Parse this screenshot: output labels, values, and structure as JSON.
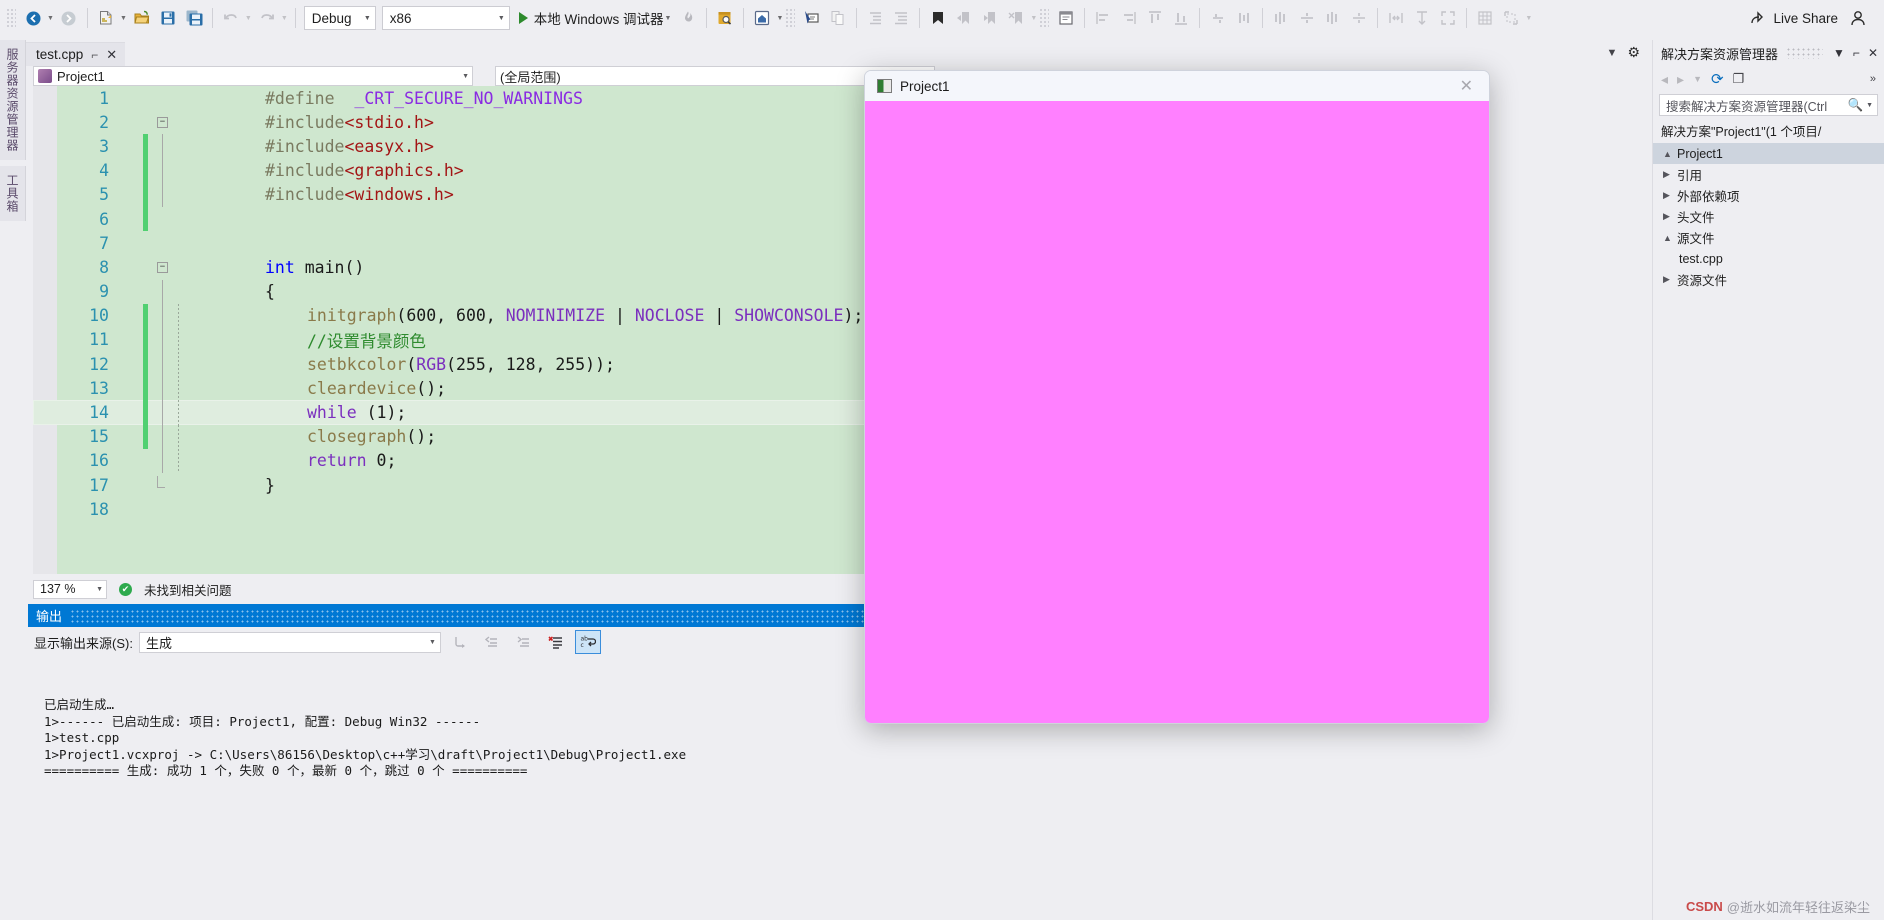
{
  "toolbar": {
    "nav_back_icon": "back-arrow-icon",
    "nav_forward_icon": "forward-arrow-icon",
    "new_item_icon": "new-file-icon",
    "open_icon": "open-folder-icon",
    "save_icon": "save-icon",
    "save_all_icon": "save-all-icon",
    "undo_icon": "undo-icon",
    "redo_icon": "redo-icon",
    "config_value": "Debug",
    "platform_value": "x86",
    "run_label": "本地 Windows 调试器",
    "hot_reload_icon": "hot-reload-icon",
    "find_icon": "find-in-files-icon",
    "home_icon": "home-icon",
    "pointer_icon": "select-element-icon",
    "copy_icon": "copy-icon",
    "indent_icon": "decrease-indent-icon",
    "outdent_icon": "increase-indent-icon",
    "bookmark_icon": "bookmark-icon",
    "prev_bookmark_icon": "previous-bookmark-icon",
    "next_bookmark_icon": "next-bookmark-icon",
    "clear_bookmark_icon": "clear-bookmarks-icon",
    "window_icon": "window-icon",
    "align_left_icon": "align-left-icon",
    "align_right_icon": "align-right-icon",
    "align_top_icon": "align-top-icon",
    "align_bottom_icon": "align-bottom-icon",
    "center_h_icon": "center-horizontally-icon",
    "center_v_icon": "center-vertically-icon",
    "space_h_icon": "space-horizontally-icon",
    "space_v_icon": "space-vertically-icon",
    "size_icon": "make-same-size-icon",
    "height_icon": "size-height-icon",
    "expand_icon": "size-to-fit-icon",
    "grid_icon": "show-grid-icon",
    "tab_order_icon": "tab-order-icon",
    "live_share_label": "Live Share",
    "account_icon": "user-account-icon"
  },
  "left_tabs": [
    {
      "label": "服务器资源管理器"
    },
    {
      "label": "工具箱"
    }
  ],
  "document_tab": {
    "title": "test.cpp",
    "pin_icon": "pin-icon",
    "close_icon": "close-icon"
  },
  "tabstrip_right": {
    "dropdown_icon": "chevron-down-icon",
    "settings_icon": "gear-icon"
  },
  "navbar": {
    "project_scope": "Project1",
    "member_scope": "(全局范围)"
  },
  "editor": {
    "lines": [
      {
        "num": "1",
        "change": false,
        "fold": "",
        "vline": "none",
        "indent": 0,
        "segments": [
          {
            "t": "#define  ",
            "c": "t-pp"
          },
          {
            "t": "_CRT_SECURE_NO_WARNINGS",
            "c": "t-mac"
          }
        ]
      },
      {
        "num": "2",
        "change": false,
        "fold": "-",
        "vline": "none",
        "indent": 0,
        "segments": [
          {
            "t": "#include",
            "c": "t-pp"
          },
          {
            "t": "<stdio.h>",
            "c": "t-str"
          }
        ]
      },
      {
        "num": "3",
        "change": true,
        "fold": "",
        "vline": "solid",
        "indent": 0,
        "segments": [
          {
            "t": "#include",
            "c": "t-pp"
          },
          {
            "t": "<easyx.h>",
            "c": "t-str"
          }
        ]
      },
      {
        "num": "4",
        "change": true,
        "fold": "",
        "vline": "solid",
        "indent": 0,
        "segments": [
          {
            "t": "#include",
            "c": "t-pp"
          },
          {
            "t": "<graphics.h>",
            "c": "t-str"
          }
        ]
      },
      {
        "num": "5",
        "change": true,
        "fold": "",
        "vline": "solid",
        "indent": 0,
        "segments": [
          {
            "t": "#include",
            "c": "t-pp"
          },
          {
            "t": "<windows.h>",
            "c": "t-str"
          }
        ]
      },
      {
        "num": "6",
        "change": true,
        "fold": "",
        "vline": "none",
        "indent": 0,
        "segments": []
      },
      {
        "num": "7",
        "change": false,
        "fold": "",
        "vline": "none",
        "indent": 0,
        "segments": []
      },
      {
        "num": "8",
        "change": false,
        "fold": "-",
        "vline": "none",
        "indent": 0,
        "segments": [
          {
            "t": "int",
            "c": "t-kw"
          },
          {
            "t": " main()",
            "c": "t-plain"
          }
        ]
      },
      {
        "num": "9",
        "change": false,
        "fold": "",
        "vline": "solid",
        "indent": 0,
        "segments": [
          {
            "t": "{",
            "c": "t-plain"
          }
        ]
      },
      {
        "num": "10",
        "change": true,
        "fold": "",
        "vline": "both",
        "indent": 1,
        "segments": [
          {
            "t": "initgraph",
            "c": "t-fn"
          },
          {
            "t": "(600, 600, ",
            "c": "t-plain"
          },
          {
            "t": "NOMINIMIZE",
            "c": "t-kw2"
          },
          {
            "t": " | ",
            "c": "t-plain"
          },
          {
            "t": "NOCLOSE",
            "c": "t-kw2"
          },
          {
            "t": " | ",
            "c": "t-plain"
          },
          {
            "t": "SHOWCONSOLE",
            "c": "t-kw2"
          },
          {
            "t": ");",
            "c": "t-plain"
          }
        ]
      },
      {
        "num": "11",
        "change": true,
        "fold": "",
        "vline": "both",
        "indent": 1,
        "segments": [
          {
            "t": "//设置背景颜色",
            "c": "t-cmt"
          }
        ]
      },
      {
        "num": "12",
        "change": true,
        "fold": "",
        "vline": "both",
        "indent": 1,
        "segments": [
          {
            "t": "setbkcolor",
            "c": "t-fn"
          },
          {
            "t": "(",
            "c": "t-plain"
          },
          {
            "t": "RGB",
            "c": "t-kw2"
          },
          {
            "t": "(255, 128, 255));",
            "c": "t-plain"
          }
        ]
      },
      {
        "num": "13",
        "change": true,
        "fold": "",
        "vline": "both",
        "indent": 1,
        "segments": [
          {
            "t": "cleardevice",
            "c": "t-fn"
          },
          {
            "t": "();",
            "c": "t-plain"
          }
        ]
      },
      {
        "num": "14",
        "change": true,
        "fold": "",
        "vline": "both",
        "indent": 1,
        "current": true,
        "segments": [
          {
            "t": "while",
            "c": "t-kw2"
          },
          {
            "t": " (1);",
            "c": "t-plain"
          }
        ]
      },
      {
        "num": "15",
        "change": true,
        "fold": "",
        "vline": "both",
        "indent": 1,
        "segments": [
          {
            "t": "closegraph",
            "c": "t-fn"
          },
          {
            "t": "();",
            "c": "t-plain"
          }
        ]
      },
      {
        "num": "16",
        "change": false,
        "fold": "",
        "vline": "both",
        "indent": 1,
        "segments": [
          {
            "t": "return",
            "c": "t-kw2"
          },
          {
            "t": " 0;",
            "c": "t-plain"
          }
        ]
      },
      {
        "num": "17",
        "change": false,
        "fold": "L",
        "vline": "none",
        "indent": 0,
        "segments": [
          {
            "t": "}",
            "c": "t-plain"
          }
        ]
      },
      {
        "num": "18",
        "change": false,
        "fold": "",
        "vline": "none",
        "indent": 0,
        "segments": []
      }
    ]
  },
  "editor_status": {
    "zoom_value": "137 %",
    "issues_icon": "check-circle-icon",
    "issues_text": "未找到相关问题"
  },
  "output": {
    "panel_title": "输出",
    "source_label": "显示输出来源(S):",
    "source_value": "生成",
    "tool_icons": [
      {
        "name": "go-to-message-icon",
        "glyph": "⇱",
        "state": "disabled"
      },
      {
        "name": "previous-message-icon",
        "glyph": "⇤",
        "state": "disabled"
      },
      {
        "name": "next-message-icon",
        "glyph": "⇥",
        "state": "disabled"
      },
      {
        "name": "clear-all-icon",
        "glyph": "✖",
        "state": "enabled"
      },
      {
        "name": "toggle-word-wrap-icon",
        "glyph": "↵",
        "state": "selected"
      }
    ],
    "log_lines": [
      "已启动生成…",
      "1>------ 已启动生成: 项目: Project1, 配置: Debug Win32 ------",
      "1>test.cpp",
      "1>Project1.vcxproj -> C:\\Users\\86156\\Desktop\\c++学习\\draft\\Project1\\Debug\\Project1.exe",
      "========== 生成: 成功 1 个，失败 0 个，最新 0 个，跳过 0 个 =========="
    ]
  },
  "solution_explorer": {
    "title": "解决方案资源管理器",
    "dropdown_icon": "chevron-down-icon",
    "pin_icon": "pin-icon",
    "close_icon": "close-icon",
    "refresh_icon": "refresh-icon",
    "collapse_icon": "collapse-all-icon",
    "more_icon": "more-options-icon",
    "search_placeholder": "搜索解决方案资源管理器(Ctrl",
    "search_icon": "search-icon",
    "search_dropdown_icon": "chevron-down-icon",
    "solution_label": "解决方案\"Project1\"(1 个项目/",
    "tree": [
      {
        "label": "Project1",
        "expander": "▲",
        "selected": true
      },
      {
        "label": "引用",
        "expander": "▶",
        "selected": false
      },
      {
        "label": "外部依赖项",
        "expander": "▶",
        "selected": false
      },
      {
        "label": "头文件",
        "expander": "▶",
        "selected": false
      },
      {
        "label": "源文件",
        "expander": "▲",
        "selected": false
      },
      {
        "label": "test.cpp",
        "expander": "",
        "selected": false
      },
      {
        "label": "资源文件",
        "expander": "▶",
        "selected": false
      }
    ]
  },
  "easyx_window": {
    "title": "Project1",
    "app_icon": "easyx-app-icon",
    "close_icon": "close-icon",
    "canvas_color": "#ff80ff"
  },
  "watermark": {
    "brand": "CSDN",
    "author": "@逝水如流年轻往返染尘"
  },
  "colors": {
    "accent": "#0078d4",
    "editor_background": "#cfe7cf",
    "change_bar": "#51d071",
    "canvas": "#ff80ff"
  }
}
